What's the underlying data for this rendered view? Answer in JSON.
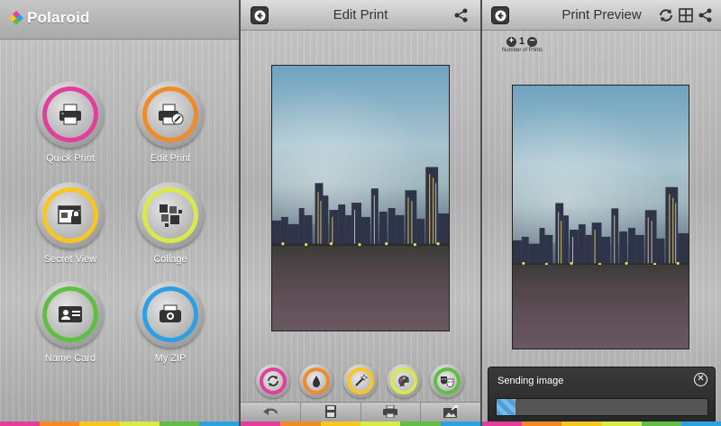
{
  "home": {
    "logo_text": "Polaroid",
    "tiles": [
      {
        "label": "Quick Print",
        "icon": "printer-icon",
        "color": "#e23e9b"
      },
      {
        "label": "Edit Print",
        "icon": "edit-printer-icon",
        "color": "#ef8b28"
      },
      {
        "label": "Secret View",
        "icon": "lock-window-icon",
        "color": "#f5c624"
      },
      {
        "label": "Collage",
        "icon": "collage-icon",
        "color": "#d9e84a"
      },
      {
        "label": "Name Card",
        "icon": "id-card-icon",
        "color": "#5fbf43"
      },
      {
        "label": "My ZIP",
        "icon": "zip-printer-icon",
        "color": "#2e9fe3"
      }
    ]
  },
  "edit": {
    "title": "Edit Print",
    "tools": [
      {
        "icon": "rotate-icon",
        "color": "#e23e9b"
      },
      {
        "icon": "water-drop-icon",
        "color": "#ef8b28"
      },
      {
        "icon": "magic-wand-icon",
        "color": "#f5c624"
      },
      {
        "icon": "palette-icon",
        "color": "#d9e84a"
      },
      {
        "icon": "theater-masks-icon",
        "color": "#5fbf43"
      }
    ],
    "actions": [
      "undo-icon",
      "save-icon",
      "print-icon",
      "export-icon"
    ]
  },
  "preview": {
    "title": "Print Preview",
    "prints_count": "1",
    "prints_label": "Number of Prints",
    "sending_title": "Sending image",
    "progress": 0.09
  },
  "colors": {
    "strip": [
      "#e23e9b",
      "#ef8b28",
      "#f5c624",
      "#d9e84a",
      "#5fbf43",
      "#2e9fe3"
    ]
  }
}
